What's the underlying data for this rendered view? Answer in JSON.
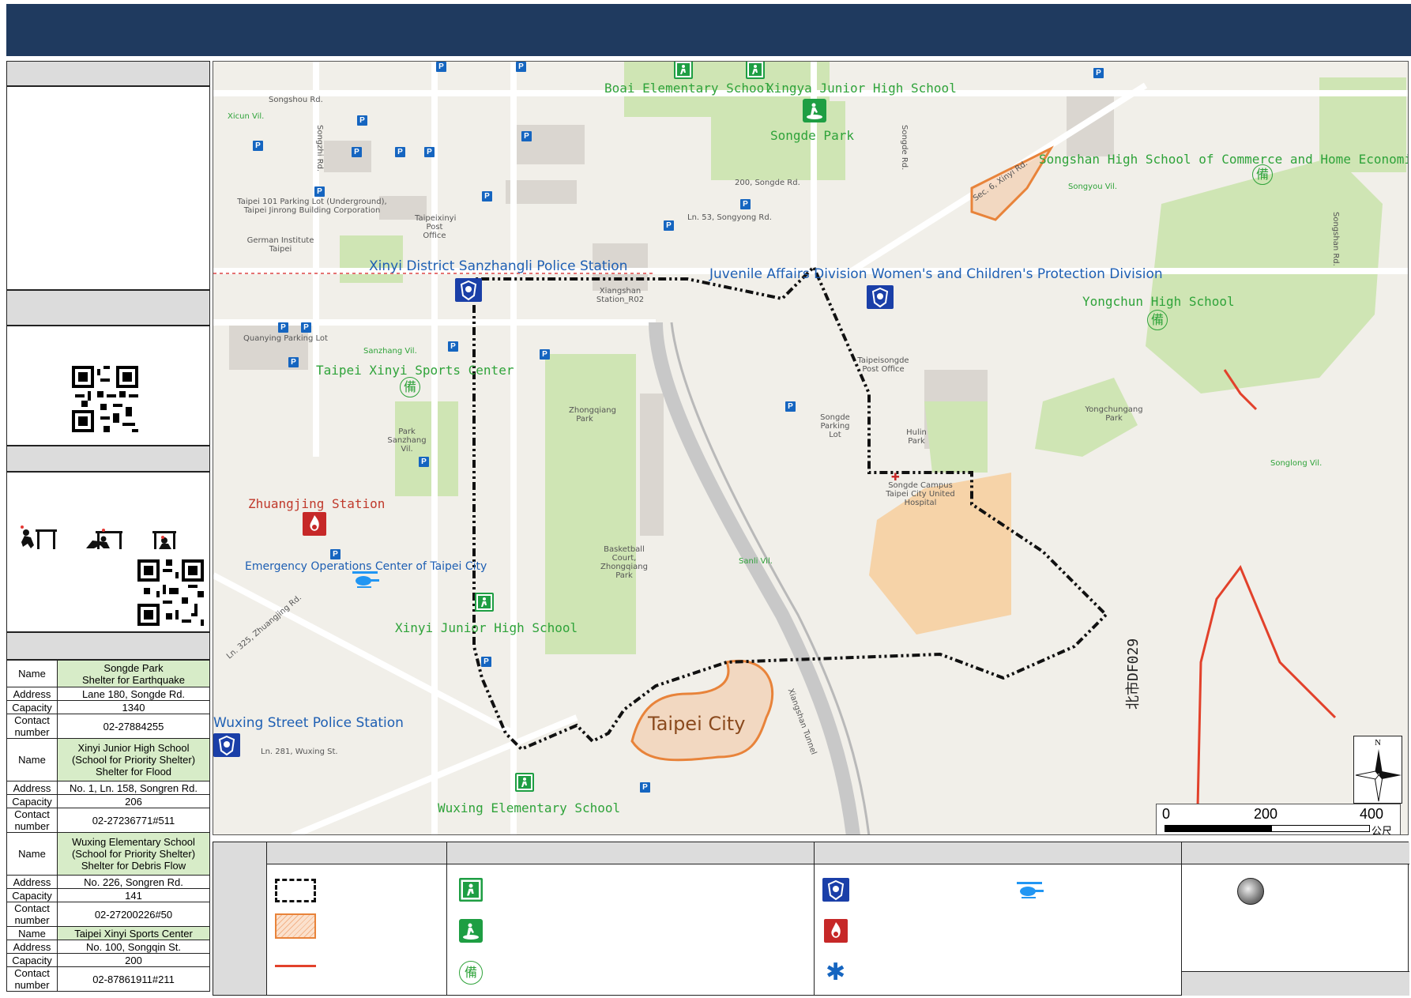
{
  "map": {
    "place_labels_green": {
      "boai_es": "Boai Elementary School",
      "xingya_jhs": "Xingya Junior High School",
      "songde_park": "Songde Park",
      "songshan_hs": "Songshan High School of Commerce and Home Economics",
      "yongchun_hs": "Yongchun High School",
      "taipei_xinyi_sports": "Taipei Xinyi Sports Center",
      "xinyi_jhs": "Xinyi Junior High School",
      "wuxing_es": "Wuxing Elementary School"
    },
    "place_labels_blue": {
      "sanzhangli_police": "Xinyi District Sanzhangli Police Station",
      "juvenile_division": "Juvenile Affairs Division Women's and Children's Protection Division",
      "wuxing_police": "Wuxing Street Police Station",
      "eoc": "Emergency Operations Center of Taipei City"
    },
    "place_labels_red": {
      "zhuangjing": "Zhuangjing Station"
    },
    "city_label": "Taipei City",
    "route_code": "北市DF029",
    "small_labels": {
      "songshou_rd": "Songshou Rd.",
      "songzhi_rd": "Songzhi Rd.",
      "songde_rd": "Songde Rd.",
      "songshan_rd": "Songshan Rd.",
      "xicun": "Xicun Vil.",
      "sanzhang": "Sanzhang Vil.",
      "songyou": "Songyou Vil.",
      "songlong": "Songlong Vil.",
      "sanli": "Sanli Vil.",
      "xiangshan_tunnel": "Xiangshan Tunnel",
      "zhongqiang_park": "Zhongqiang Park",
      "yongchungang_park": "Yongchungang Park",
      "hulin_park": "Hulin Park",
      "park_sanzhang": "Park Sanzhang Vil.",
      "songde_campus": "Songde Campus Taipei City United Hospital",
      "taipei_101_parking": "Taipei 101 Parking Lot (Underground), Taipei Jinrong Building Corporation",
      "german_institute": "German Institute Taipei",
      "quanying_parking": "Quanying Parking Lot",
      "songde_parking": "Songde Parking Lot",
      "taipeisongde_post": "Taipeisongde Post Office",
      "taipeixinyi_post": "Taipeixinyi Post Office",
      "xiangshan_station": "Xiangshan Station_R02",
      "basketball": "Basketball Court, Zhongqiang Park",
      "lane_200_songde": "200, Songde Rd.",
      "songyong_rd": "Ln. 53, Songyong Rd.",
      "sec6_xinyi": "Sec. 6, Xinyi Rd.",
      "wuxing_st": "Ln. 281, Wuxing St.",
      "zhuangjing_rd": "Ln. 325, Zhuangjing Rd."
    }
  },
  "scale_bar": {
    "ticks": [
      "0",
      "200",
      "400"
    ],
    "unit": "公尺",
    "north": "N"
  },
  "shelters": [
    {
      "name": "Songde Park\nShelter for Earthquake",
      "address": "Lane 180, Songde Rd.",
      "capacity": "1340",
      "contact": "02-27884255"
    },
    {
      "name": "Xinyi Junior High School\n(School for Priority Shelter)\nShelter for Flood",
      "address": "No. 1, Ln. 158, Songren Rd.",
      "capacity": "206",
      "contact": "02-27236771#511"
    },
    {
      "name": "Wuxing Elementary School\n(School for Priority Shelter)\nShelter for Debris Flow",
      "address": "No. 226, Songren Rd.",
      "capacity": "141",
      "contact": "02-27200226#50"
    },
    {
      "name": "Taipei Xinyi Sports Center",
      "address": "No. 100, Songqin St.",
      "capacity": "200",
      "contact": "02-87861911#211"
    }
  ],
  "table_labels": {
    "name": "Name",
    "address": "Address",
    "capacity": "Capacity",
    "contact": "Contact number"
  },
  "colors": {
    "title_bar": "#1f3a5f",
    "route": "#111111",
    "hazard_area": "#e8833a",
    "debris_stream": "#e2412b",
    "park": "#cfe5b4",
    "hospital_area": "#f6d3a8",
    "shelter_name_fill": "#d7ecc8"
  },
  "icons": {
    "shelter_exit": "evacuation-exit-icon",
    "shelter_park": "park-shelter-icon",
    "reserve": "reserve-shelter-icon",
    "police": "police-icon",
    "fire": "fire-department-icon",
    "medical": "medical-star-icon",
    "helicopter": "helicopter-icon",
    "gauge": "rain-gauge-icon"
  }
}
